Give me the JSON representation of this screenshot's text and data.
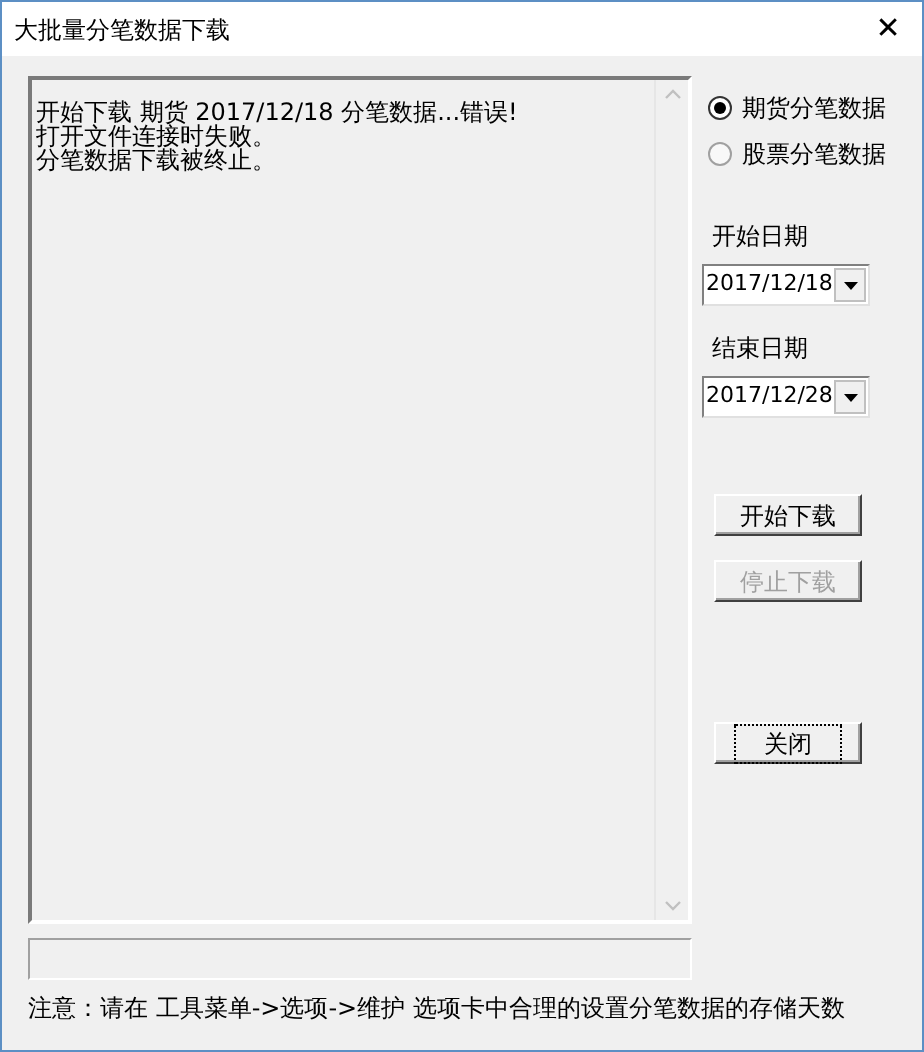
{
  "window": {
    "title": "大批量分笔数据下载",
    "close": "✕"
  },
  "log": {
    "lines": [
      "开始下载 期货 2017/12/18 分笔数据...错误!",
      "打开文件连接时失败。",
      "分笔数据下载被终止。"
    ]
  },
  "progress": {
    "level": 0
  },
  "data_types": [
    {
      "label": "期货分笔数据",
      "selected": true
    },
    {
      "label": "股票分笔数据",
      "selected": false
    }
  ],
  "start_date": {
    "label": "开始日期",
    "value": "2017/12/18"
  },
  "end_date": {
    "label": "结束日期",
    "value": "2017/12/28"
  },
  "buttons": [
    {
      "label": "开始下载",
      "disabled": false,
      "focused": false
    },
    {
      "label": "停止下载",
      "disabled": true,
      "focused": false
    },
    {
      "label": "关闭",
      "disabled": false,
      "focused": true
    }
  ],
  "note": "注意：请在 工具菜单->选项->维护 选项卡中合理的设置分笔数据的存储天数"
}
